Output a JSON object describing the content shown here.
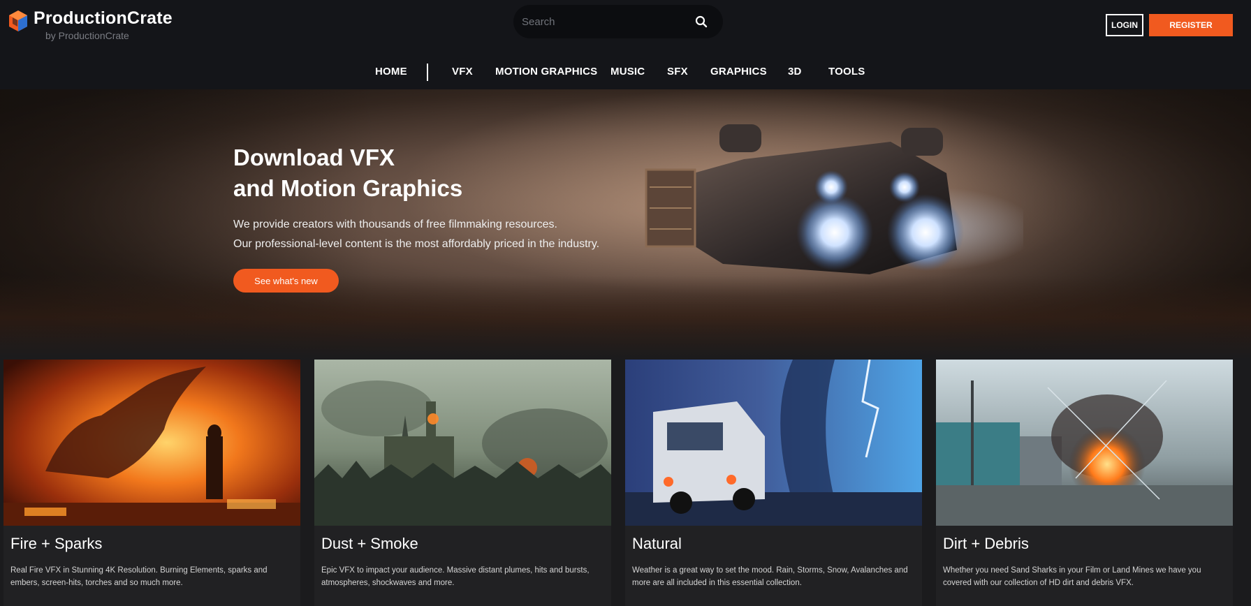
{
  "brand": {
    "name": "ProductionCrate",
    "subtitle": "by ProductionCrate"
  },
  "search": {
    "placeholder": "Search"
  },
  "auth": {
    "login_label": "LOGIN",
    "register_label": "REGISTER"
  },
  "nav": {
    "items": [
      {
        "label": "HOME"
      },
      {
        "label": "VFX"
      },
      {
        "label": "MOTION GRAPHICS"
      },
      {
        "label": "MUSIC"
      },
      {
        "label": "SFX"
      },
      {
        "label": "GRAPHICS"
      },
      {
        "label": "3D"
      },
      {
        "label": "TOOLS"
      }
    ]
  },
  "hero": {
    "title_line1": "Download VFX",
    "title_line2": "and Motion Graphics",
    "desc_line1": "We provide creators with thousands of free filmmaking resources.",
    "desc_line2": "Our professional-level content is the most affordably priced in the industry.",
    "cta_label": "See what's new"
  },
  "cards": [
    {
      "title": "Fire + Sparks",
      "description": "Real Fire VFX in Stunning 4K Resolution. Burning Elements, sparks and embers, screen-hits, torches and so much more."
    },
    {
      "title": "Dust + Smoke",
      "description": "Epic VFX to impact your audience. Massive distant plumes, hits and bursts, atmospheres, shockwaves and more."
    },
    {
      "title": "Natural",
      "description": "Weather is a great way to set the mood. Rain, Storms, Snow, Avalanches and more are all included in this essential collection."
    },
    {
      "title": "Dirt + Debris",
      "description": "Whether you need Sand Sharks in your Film or Land Mines we have you covered with our collection of HD dirt and debris VFX."
    }
  ],
  "colors": {
    "accent": "#f15a1f",
    "header_bg": "#141519",
    "page_bg": "#1b1b1d",
    "card_bg": "#212123"
  }
}
